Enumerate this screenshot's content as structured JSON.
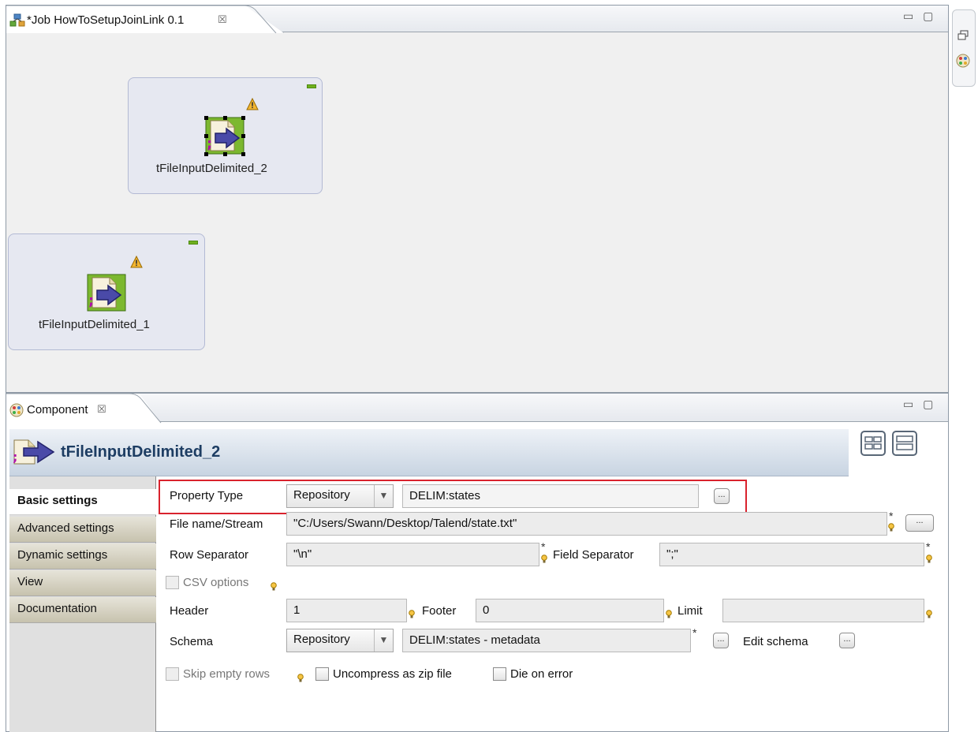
{
  "editor": {
    "tab_title": "*Job HowToSetupJoinLink 0.1",
    "tab_close": "☒",
    "win_controls": "▭ ▢",
    "nodes": [
      {
        "label": "tFileInputDelimited_2",
        "selected": true
      },
      {
        "label": "tFileInputDelimited_1",
        "selected": false
      }
    ]
  },
  "component_view": {
    "tab_title": "Component",
    "tab_close": "☒",
    "win_controls": "▭ ▢",
    "header_title": "tFileInputDelimited_2",
    "vertical_tabs": [
      {
        "label": "Basic settings",
        "active": true
      },
      {
        "label": "Advanced settings",
        "active": false
      },
      {
        "label": "Dynamic settings",
        "active": false
      },
      {
        "label": "View",
        "active": false
      },
      {
        "label": "Documentation",
        "active": false
      }
    ],
    "form": {
      "property_type_label": "Property Type",
      "property_type_value": "Repository",
      "property_repo_value": "DELIM:states",
      "file_name_label": "File name/Stream",
      "file_name_value": "\"C:/Users/Swann/Desktop/Talend/state.txt\"",
      "row_sep_label": "Row Separator",
      "row_sep_value": "\"\\n\"",
      "field_sep_label": "Field Separator",
      "field_sep_value": "\";\"",
      "csv_options_label": "CSV options",
      "header_label": "Header",
      "header_value": "1",
      "footer_label": "Footer",
      "footer_value": "0",
      "limit_label": "Limit",
      "limit_value": "",
      "schema_label": "Schema",
      "schema_type_value": "Repository",
      "schema_repo_value": "DELIM:states - metadata",
      "edit_schema_label": "Edit schema",
      "skip_empty_label": "Skip empty rows",
      "uncompress_label": "Uncompress as zip file",
      "die_on_error_label": "Die on error",
      "star": "*",
      "ellipsis": "..."
    }
  },
  "colors": {
    "highlight_border": "#d9222d",
    "header_title": "#1d3d63",
    "component_green": "#7cb82f",
    "component_arrow": "#4a4aa8"
  }
}
